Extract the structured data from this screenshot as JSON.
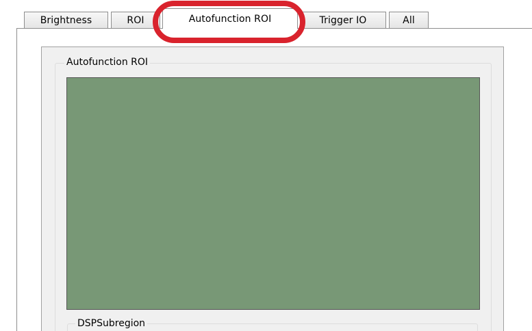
{
  "tabs": [
    {
      "label": "Brightness",
      "active": false
    },
    {
      "label": "ROI",
      "active": false
    },
    {
      "label": "Autofunction ROI",
      "active": true
    },
    {
      "label": "Trigger IO",
      "active": false
    },
    {
      "label": "All",
      "active": false
    }
  ],
  "panel": {
    "groupbox_label": "Autofunction ROI",
    "roi_canvas_color": "#789876",
    "sub_groupbox_label": "DSPSubregion"
  },
  "annotation": {
    "highlight_color": "#d9232d",
    "highlighted_tab": "Autofunction ROI"
  }
}
